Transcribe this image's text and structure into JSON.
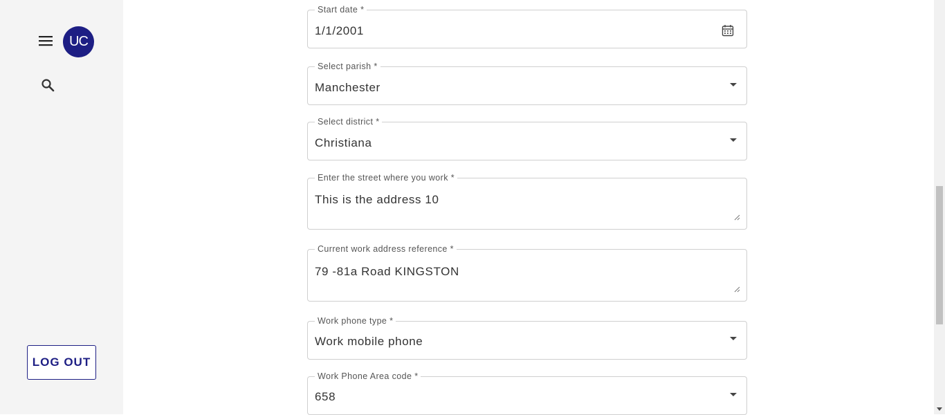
{
  "sidebar": {
    "avatar_text": "UC",
    "logout_label": "LOG OUT"
  },
  "form": {
    "start_date": {
      "label": "Start date *",
      "value": "1/1/2001"
    },
    "parish": {
      "label": "Select parish *",
      "value": "Manchester"
    },
    "district": {
      "label": "Select district *",
      "value": "Christiana"
    },
    "street": {
      "label": "Enter the street where you work *",
      "value": "This is the address 10"
    },
    "reference": {
      "label": "Current work address reference *",
      "value": "79 -81a Road KINGSTON"
    },
    "phone_type": {
      "label": "Work phone type *",
      "value": "Work mobile phone"
    },
    "area_code": {
      "label": "Work Phone Area code *",
      "value": "658"
    }
  },
  "colors": {
    "brand": "#1d1e84",
    "sidebar_bg": "#f4f4f4",
    "border": "#cfcfcf"
  },
  "icons": [
    "menu-icon",
    "search-icon",
    "calendar-icon",
    "dropdown-caret-icon"
  ]
}
